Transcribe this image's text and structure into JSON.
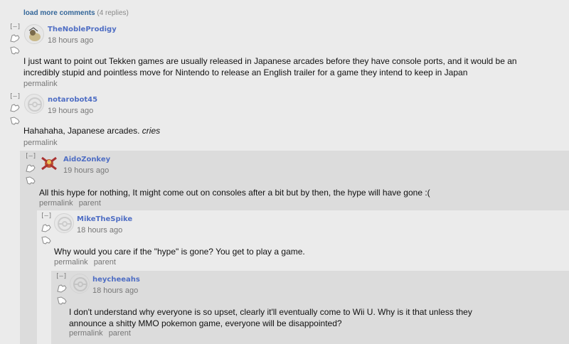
{
  "load_more": {
    "label": "load more comments",
    "count": "(4 replies)"
  },
  "comments": [
    {
      "collapse": "[–]",
      "author": "TheNobleProdigy",
      "time": "18 hours ago",
      "body": "I just want to point out Tekken games are usually released in Japanese arcades before they have console ports, and it would be an incredibly stupid and pointless move for Nintendo to release an English trailer for a game they intend to keep in Japan",
      "links": [
        "permalink"
      ]
    },
    {
      "collapse": "[–]",
      "author": "notarobot45",
      "time": "19 hours ago",
      "body_plain": "Hahahaha, Japanese arcades. ",
      "body_em": "cries",
      "links": [
        "permalink"
      ]
    },
    {
      "collapse": "[–]",
      "author": "AidoZonkey",
      "time": "19 hours ago",
      "body": "All this hype for nothing, It might come out on consoles after a bit but by then, the hype will have gone :(",
      "links": [
        "permalink",
        "parent"
      ]
    },
    {
      "collapse": "[–]",
      "author": "MikeTheSpike",
      "time": "18 hours ago",
      "body": "Why would you care if the \"hype\" is gone? You get to play a game.",
      "links": [
        "permalink",
        "parent"
      ]
    },
    {
      "collapse": "[–]",
      "author": "heycheeahs",
      "time": "18 hours ago",
      "body": "I don't understand why everyone is so upset, clearly it'll eventually come to Wii U. Why is it that unless they announce a shitty MMO pokemon game, everyone will be disappointed?",
      "links": [
        "permalink",
        "parent"
      ]
    }
  ],
  "colors": {
    "author": "#4f6ec4",
    "nest_bg": "#dcdcdc",
    "page_bg": "#ebebeb"
  }
}
